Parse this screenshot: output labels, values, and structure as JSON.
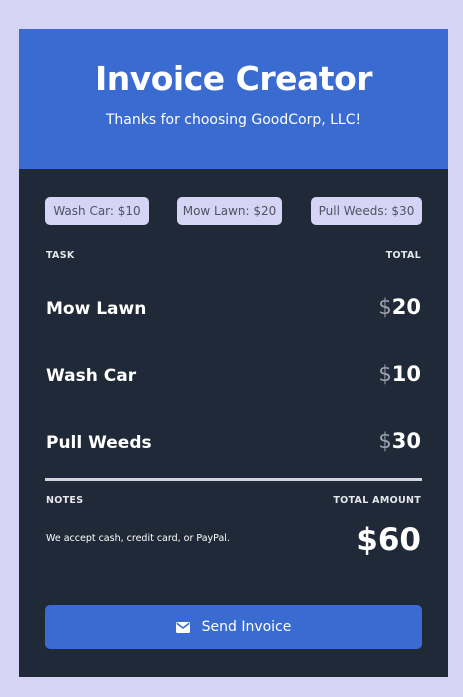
{
  "header": {
    "title": "Invoice Creator",
    "subtitle": "Thanks for choosing GoodCorp, LLC!"
  },
  "task_buttons": [
    {
      "label": "Wash Car: $10"
    },
    {
      "label": "Mow Lawn: $20"
    },
    {
      "label": "Pull Weeds: $30"
    }
  ],
  "table": {
    "task_header": "TASK",
    "total_header": "TOTAL",
    "currency": "$",
    "rows": [
      {
        "task": "Mow Lawn",
        "amount": "20"
      },
      {
        "task": "Wash Car",
        "amount": "10"
      },
      {
        "task": "Pull Weeds",
        "amount": "30"
      }
    ]
  },
  "summary": {
    "notes_header": "NOTES",
    "total_amount_header": "TOTAL AMOUNT",
    "notes_text": "We accept cash, credit card, or PayPal.",
    "total_amount": "$60"
  },
  "send_button": {
    "label": "Send Invoice",
    "icon": "envelope-icon"
  },
  "colors": {
    "page_background": "#d5d4f4",
    "card_background": "#1f2937",
    "accent": "#3a6bd0",
    "task_button_background": "#d5d4f4"
  }
}
